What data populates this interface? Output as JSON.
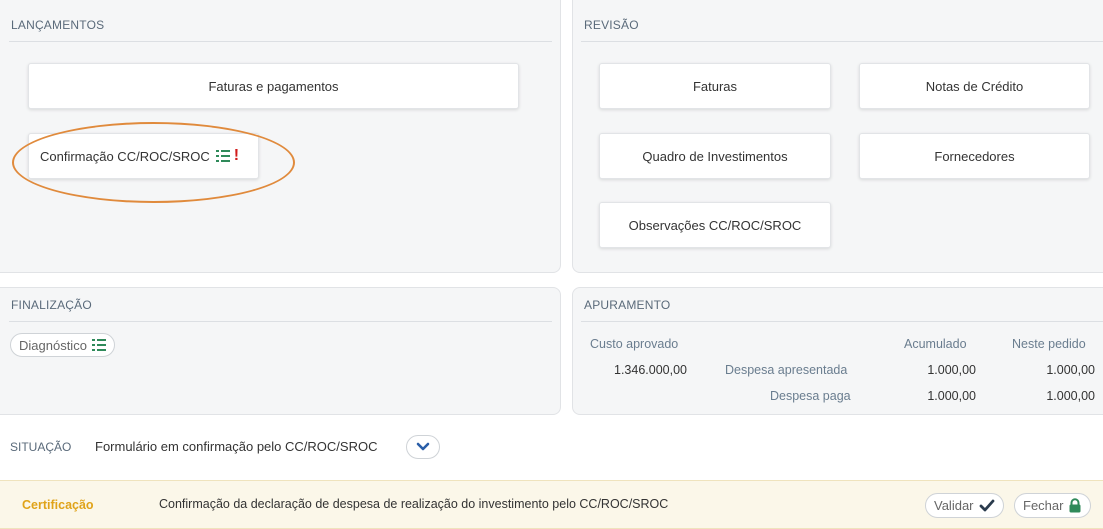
{
  "lancamentos": {
    "title": "LANÇAMENTOS",
    "faturas_pagamentos_label": "Faturas e pagamentos",
    "confirmacao_label": "Confirmação CC/ROC/SROC"
  },
  "revisao": {
    "title": "REVISÃO",
    "buttons": {
      "faturas": "Faturas",
      "notas_credito": "Notas de Crédito",
      "quadro_investimentos": "Quadro de Investimentos",
      "fornecedores": "Fornecedores",
      "observacoes": "Observações CC/ROC/SROC"
    }
  },
  "finalizacao": {
    "title": "FINALIZAÇÃO",
    "diagnostico_label": "Diagnóstico"
  },
  "apuramento": {
    "title": "APURAMENTO",
    "custo_aprovado_label": "Custo aprovado",
    "custo_aprovado_value": "1.346.000,00",
    "col_acumulado": "Acumulado",
    "col_neste_pedido": "Neste pedido",
    "rows": [
      {
        "label": "Despesa apresentada",
        "acumulado": "1.000,00",
        "neste_pedido": "1.000,00"
      },
      {
        "label": "Despesa paga",
        "acumulado": "1.000,00",
        "neste_pedido": "1.000,00"
      }
    ]
  },
  "situacao": {
    "label": "SITUAÇÃO",
    "text": "Formulário em confirmação pelo CC/ROC/SROC"
  },
  "certificacao": {
    "label": "Certificação",
    "text": "Confirmação da declaração de despesa de realização do investimento pelo CC/ROC/SROC",
    "validar_label": "Validar",
    "fechar_label": "Fechar"
  },
  "colors": {
    "accent_green": "#2f8a5a",
    "alert_red": "#d11b1b",
    "highlight_orange": "#e08a3c",
    "cert_yellow": "#e0a319",
    "chevron_blue": "#2a5ea8"
  }
}
